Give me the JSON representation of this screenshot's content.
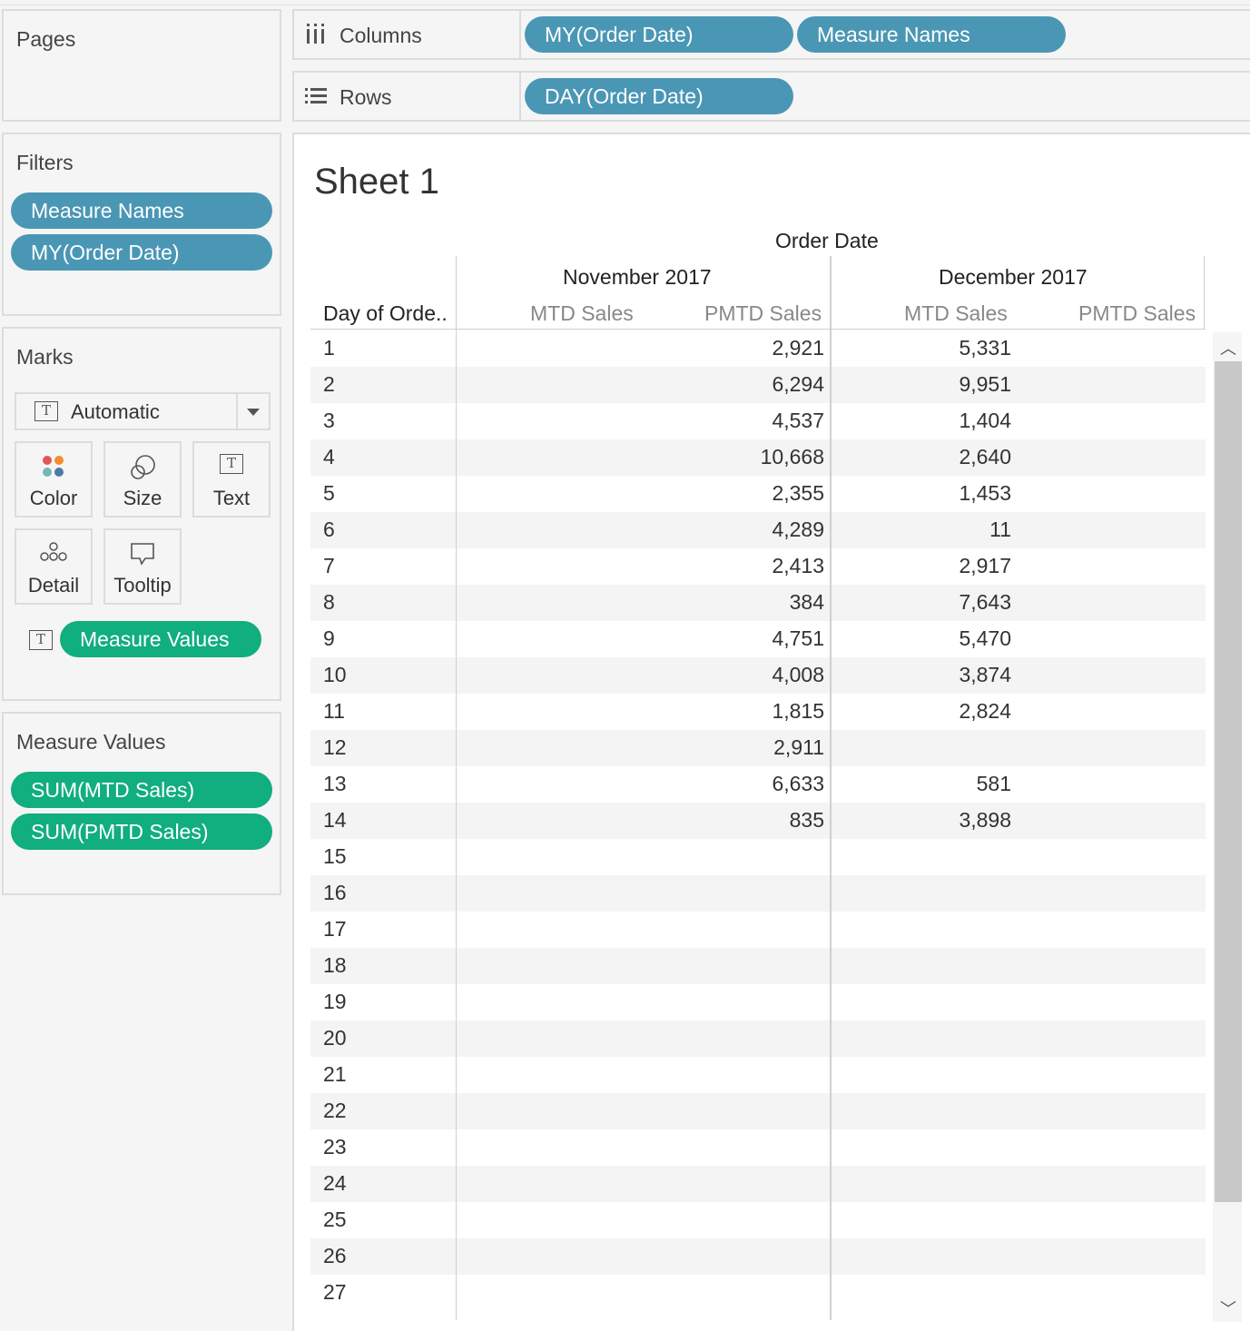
{
  "pages": {
    "title": "Pages"
  },
  "filters": {
    "title": "Filters",
    "pills": [
      "Measure Names",
      "MY(Order Date)"
    ]
  },
  "marks": {
    "title": "Marks",
    "mark_type": "Automatic",
    "buttons": {
      "color": "Color",
      "size": "Size",
      "text": "Text",
      "detail": "Detail",
      "tooltip": "Tooltip"
    },
    "text_pill": "Measure Values"
  },
  "measure_values": {
    "title": "Measure Values",
    "pills": [
      "SUM(MTD Sales)",
      "SUM(PMTD Sales)"
    ]
  },
  "columns_shelf": {
    "label": "Columns",
    "pills": [
      "MY(Order Date)",
      "Measure Names"
    ]
  },
  "rows_shelf": {
    "label": "Rows",
    "pills": [
      "DAY(Order Date)"
    ]
  },
  "sheet": {
    "title": "Sheet 1",
    "header_top": "Order Date",
    "months": [
      "November 2017",
      "December 2017"
    ],
    "row_header": "Day of Orde..",
    "measures": [
      "MTD Sales",
      "PMTD Sales",
      "MTD Sales",
      "PMTD Sales"
    ],
    "rows": [
      {
        "day": "1",
        "nov_pmtd": "2,921",
        "dec_mtd": "5,331"
      },
      {
        "day": "2",
        "nov_pmtd": "6,294",
        "dec_mtd": "9,951"
      },
      {
        "day": "3",
        "nov_pmtd": "4,537",
        "dec_mtd": "1,404"
      },
      {
        "day": "4",
        "nov_pmtd": "10,668",
        "dec_mtd": "2,640"
      },
      {
        "day": "5",
        "nov_pmtd": "2,355",
        "dec_mtd": "1,453"
      },
      {
        "day": "6",
        "nov_pmtd": "4,289",
        "dec_mtd": "11"
      },
      {
        "day": "7",
        "nov_pmtd": "2,413",
        "dec_mtd": "2,917"
      },
      {
        "day": "8",
        "nov_pmtd": "384",
        "dec_mtd": "7,643"
      },
      {
        "day": "9",
        "nov_pmtd": "4,751",
        "dec_mtd": "5,470"
      },
      {
        "day": "10",
        "nov_pmtd": "4,008",
        "dec_mtd": "3,874"
      },
      {
        "day": "11",
        "nov_pmtd": "1,815",
        "dec_mtd": "2,824"
      },
      {
        "day": "12",
        "nov_pmtd": "2,911",
        "dec_mtd": ""
      },
      {
        "day": "13",
        "nov_pmtd": "6,633",
        "dec_mtd": "581"
      },
      {
        "day": "14",
        "nov_pmtd": "835",
        "dec_mtd": "3,898"
      },
      {
        "day": "15",
        "nov_pmtd": "",
        "dec_mtd": ""
      },
      {
        "day": "16",
        "nov_pmtd": "",
        "dec_mtd": ""
      },
      {
        "day": "17",
        "nov_pmtd": "",
        "dec_mtd": ""
      },
      {
        "day": "18",
        "nov_pmtd": "",
        "dec_mtd": ""
      },
      {
        "day": "19",
        "nov_pmtd": "",
        "dec_mtd": ""
      },
      {
        "day": "20",
        "nov_pmtd": "",
        "dec_mtd": ""
      },
      {
        "day": "21",
        "nov_pmtd": "",
        "dec_mtd": ""
      },
      {
        "day": "22",
        "nov_pmtd": "",
        "dec_mtd": ""
      },
      {
        "day": "23",
        "nov_pmtd": "",
        "dec_mtd": ""
      },
      {
        "day": "24",
        "nov_pmtd": "",
        "dec_mtd": ""
      },
      {
        "day": "25",
        "nov_pmtd": "",
        "dec_mtd": ""
      },
      {
        "day": "26",
        "nov_pmtd": "",
        "dec_mtd": ""
      },
      {
        "day": "27",
        "nov_pmtd": "",
        "dec_mtd": ""
      }
    ]
  },
  "colors": {
    "dimension_pill": "#4a97b5",
    "measure_pill": "#11ae7f"
  }
}
